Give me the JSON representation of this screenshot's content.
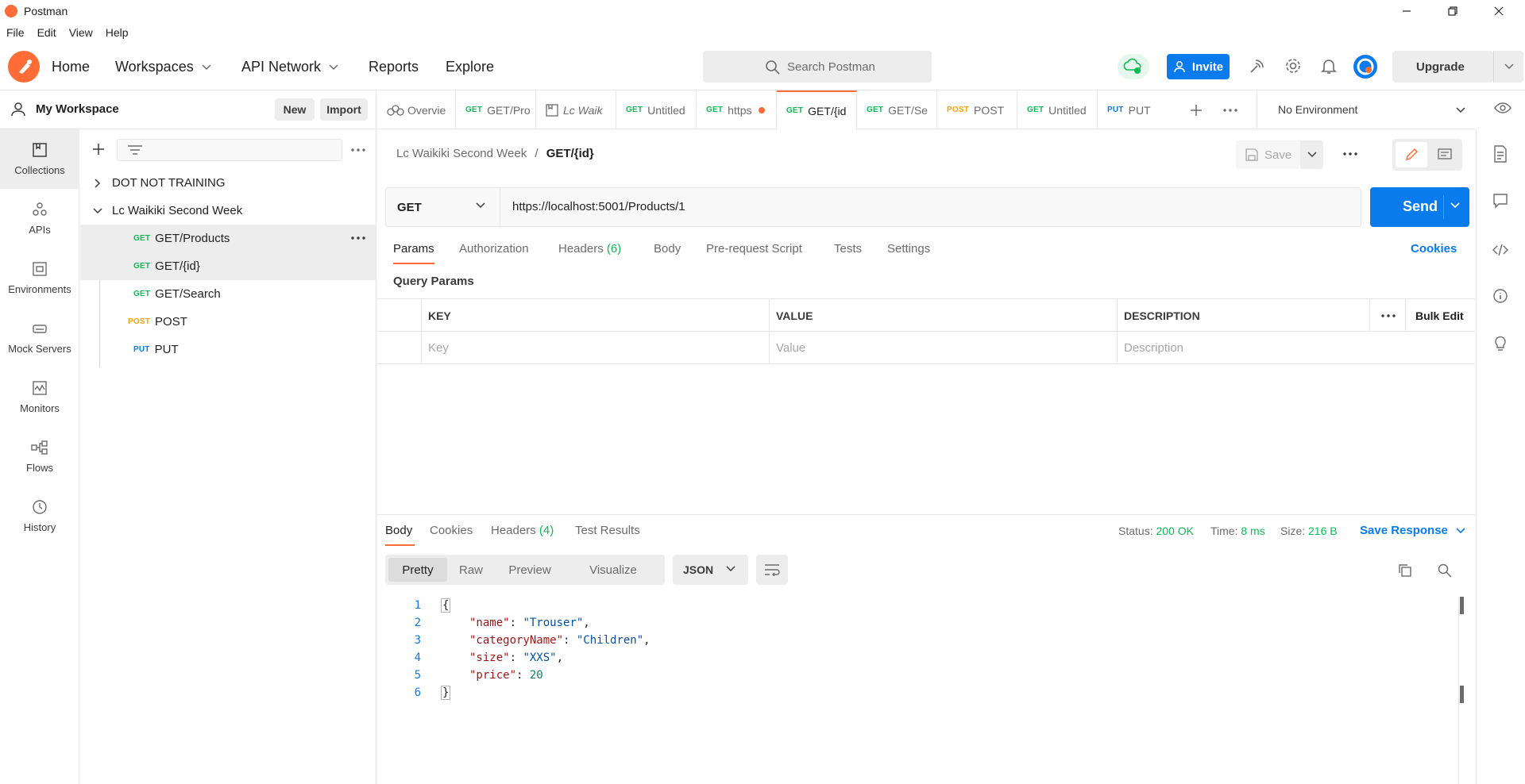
{
  "window": {
    "title": "Postman",
    "controls": [
      "minimize",
      "restore",
      "close"
    ]
  },
  "menu": [
    "File",
    "Edit",
    "View",
    "Help"
  ],
  "header": {
    "nav": [
      {
        "label": "Home",
        "dropdown": false
      },
      {
        "label": "Workspaces",
        "dropdown": true
      },
      {
        "label": "API Network",
        "dropdown": true
      },
      {
        "label": "Reports",
        "dropdown": false
      },
      {
        "label": "Explore",
        "dropdown": false
      }
    ],
    "search_placeholder": "Search Postman",
    "invite_label": "Invite",
    "upgrade_label": "Upgrade"
  },
  "workspace": {
    "name": "My Workspace",
    "new_label": "New",
    "import_label": "Import"
  },
  "rail": [
    {
      "label": "Collections",
      "icon": "collections-icon",
      "active": true
    },
    {
      "label": "APIs",
      "icon": "apis-icon",
      "active": false
    },
    {
      "label": "Environments",
      "icon": "environments-icon",
      "active": false
    },
    {
      "label": "Mock Servers",
      "icon": "mock-servers-icon",
      "active": false
    },
    {
      "label": "Monitors",
      "icon": "monitors-icon",
      "active": false
    },
    {
      "label": "Flows",
      "icon": "flows-icon",
      "active": false
    },
    {
      "label": "History",
      "icon": "history-icon",
      "active": false
    }
  ],
  "collections": {
    "items": [
      {
        "name": "DOT NOT TRAINING",
        "expanded": false
      },
      {
        "name": "Lc Waikiki Second Week",
        "expanded": true
      }
    ],
    "requests": [
      {
        "method": "GET",
        "name": "GET/Products"
      },
      {
        "method": "GET",
        "name": "GET/{id}"
      },
      {
        "method": "GET",
        "name": "GET/Search"
      },
      {
        "method": "POST",
        "name": "POST"
      },
      {
        "method": "PUT",
        "name": "PUT"
      }
    ]
  },
  "tabs": [
    {
      "method": "",
      "label": "Overvie"
    },
    {
      "method": "GET",
      "label": "GET/Pro"
    },
    {
      "method": "",
      "label": "Lc Waik"
    },
    {
      "method": "GET",
      "label": "Untitled"
    },
    {
      "method": "GET",
      "label": "https"
    },
    {
      "method": "GET",
      "label": "GET/{id"
    },
    {
      "method": "GET",
      "label": "GET/Se"
    },
    {
      "method": "POST",
      "label": "POST"
    },
    {
      "method": "GET",
      "label": "Untitled"
    },
    {
      "method": "PUT",
      "label": "PUT"
    }
  ],
  "environment": "No Environment",
  "request": {
    "breadcrumb_parent": "Lc Waikiki Second Week",
    "breadcrumb_sep": "/",
    "breadcrumb_current": "GET/{id}",
    "save_label": "Save",
    "method": "GET",
    "url": "https://localhost:5001/Products/1",
    "send_label": "Send",
    "tabs": {
      "params": "Params",
      "authorization": "Authorization",
      "headers": "Headers",
      "headers_count": "(6)",
      "body": "Body",
      "prerequest": "Pre-request Script",
      "tests": "Tests",
      "settings": "Settings"
    },
    "cookies_label": "Cookies",
    "query_params_label": "Query Params",
    "table": {
      "headers": [
        "KEY",
        "VALUE",
        "DESCRIPTION"
      ],
      "placeholders": [
        "Key",
        "Value",
        "Description"
      ],
      "bulk_edit": "Bulk Edit"
    }
  },
  "response": {
    "tabs": {
      "body": "Body",
      "cookies": "Cookies",
      "headers": "Headers",
      "headers_count": "(4)",
      "test_results": "Test Results"
    },
    "status_label": "Status:",
    "status_value": "200 OK",
    "time_label": "Time:",
    "time_value": "8 ms",
    "size_label": "Size:",
    "size_value": "216 B",
    "save_response": "Save Response",
    "views": [
      "Pretty",
      "Raw",
      "Preview",
      "Visualize"
    ],
    "format": "JSON",
    "body_lines": [
      {
        "n": "1",
        "key": "",
        "value": "",
        "open": "{"
      },
      {
        "n": "2",
        "key": "\"name\"",
        "value": "\"Trouser\"",
        "comma": ","
      },
      {
        "n": "3",
        "key": "\"categoryName\"",
        "value": "\"Children\"",
        "comma": ","
      },
      {
        "n": "4",
        "key": "\"size\"",
        "value": "\"XXS\"",
        "comma": ","
      },
      {
        "n": "5",
        "key": "\"price\"",
        "value": "20",
        "comma": ""
      },
      {
        "n": "6",
        "key": "",
        "value": "",
        "open": "}"
      }
    ]
  },
  "colors": {
    "brand": "#ff6c37",
    "accent": "#097bed",
    "get": "#0cbb52",
    "post": "#f3a20c",
    "put": "#097bed"
  }
}
